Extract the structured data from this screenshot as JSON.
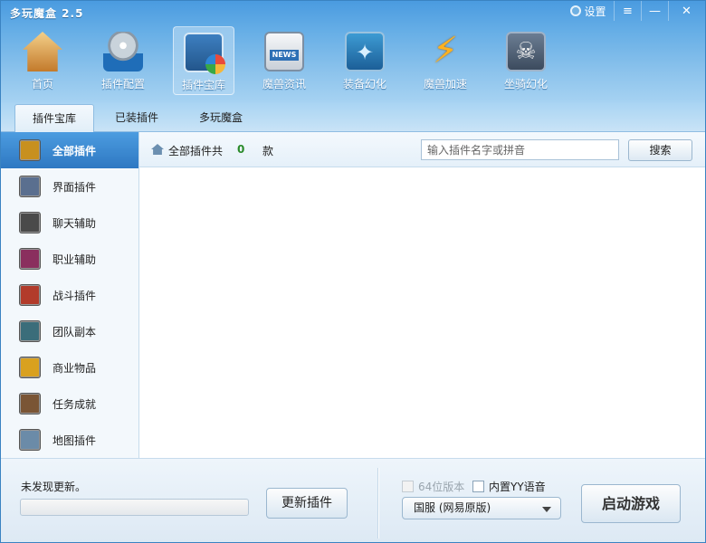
{
  "app": {
    "title": "多玩魔盒 2.5"
  },
  "window_controls": {
    "settings_label": "设置"
  },
  "toolbar": {
    "items": [
      {
        "label": "首页",
        "icon": "home-icon"
      },
      {
        "label": "插件配置",
        "icon": "plugin-config-icon"
      },
      {
        "label": "插件宝库",
        "icon": "plugin-library-icon",
        "active": true
      },
      {
        "label": "魔兽资讯",
        "icon": "news-icon"
      },
      {
        "label": "装备幻化",
        "icon": "equipment-transmog-icon"
      },
      {
        "label": "魔兽加速",
        "icon": "speed-boost-icon"
      },
      {
        "label": "坐骑幻化",
        "icon": "mount-transmog-icon"
      }
    ]
  },
  "tabs": [
    {
      "label": "插件宝库",
      "active": true
    },
    {
      "label": "已装插件"
    },
    {
      "label": "多玩魔盒"
    }
  ],
  "sidebar": {
    "items": [
      {
        "label": "全部插件",
        "active": true,
        "color": "#c8901f"
      },
      {
        "label": "界面插件",
        "color": "#5a6f8f"
      },
      {
        "label": "聊天辅助",
        "color": "#4a4a4a"
      },
      {
        "label": "职业辅助",
        "color": "#8a2f5e"
      },
      {
        "label": "战斗插件",
        "color": "#b23b2b"
      },
      {
        "label": "团队副本",
        "color": "#3b6d7a"
      },
      {
        "label": "商业物品",
        "color": "#d9a11f"
      },
      {
        "label": "任务成就",
        "color": "#7a5535"
      },
      {
        "label": "地图插件",
        "color": "#6b8ba8"
      }
    ]
  },
  "main": {
    "header_prefix": "全部插件共",
    "count": "0",
    "header_suffix": "款",
    "search_placeholder": "输入插件名字或拼音",
    "search_button": "搜索"
  },
  "bottom": {
    "update_status": "未发现更新。",
    "update_progress": 0,
    "update_button": "更新插件",
    "checkbox_64": "64位版本",
    "checkbox_yy": "内置YY语音",
    "server_selected": "国服 (网易原版)",
    "launch_button": "启动游戏"
  }
}
